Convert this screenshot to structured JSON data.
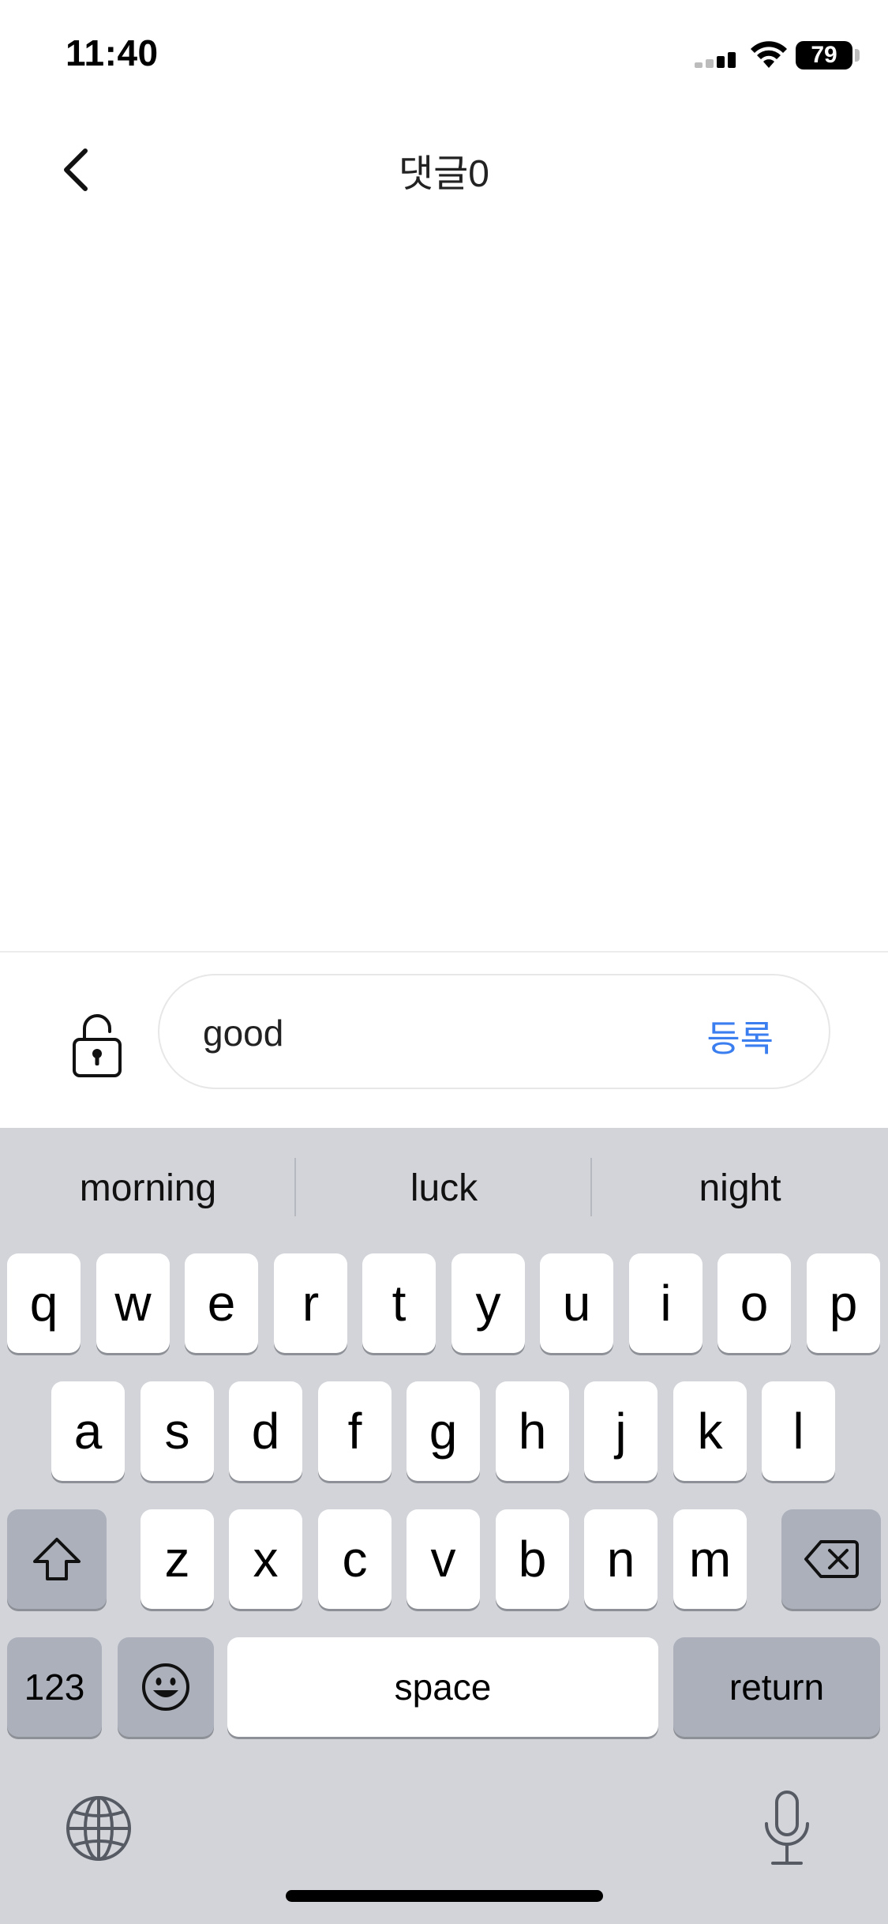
{
  "status_bar": {
    "time": "11:40",
    "battery": "79"
  },
  "header": {
    "title": "댓글0",
    "back_icon": "chevron-left-icon"
  },
  "comment_input": {
    "lock_icon": "unlocked-padlock-icon",
    "value": "good",
    "submit_label": "등록",
    "submit_color": "#3b7ef0"
  },
  "keyboard": {
    "suggestions": [
      "morning",
      "luck",
      "night"
    ],
    "row1": [
      "q",
      "w",
      "e",
      "r",
      "t",
      "y",
      "u",
      "i",
      "o",
      "p"
    ],
    "row2": [
      "a",
      "s",
      "d",
      "f",
      "g",
      "h",
      "j",
      "k",
      "l"
    ],
    "row3": [
      "z",
      "x",
      "c",
      "v",
      "b",
      "n",
      "m"
    ],
    "numbers_label": "123",
    "space_label": "space",
    "return_label": "return",
    "shift_icon": "shift-icon",
    "delete_icon": "delete-icon",
    "emoji_icon": "emoji-icon",
    "globe_icon": "globe-icon",
    "mic_icon": "microphone-icon"
  }
}
